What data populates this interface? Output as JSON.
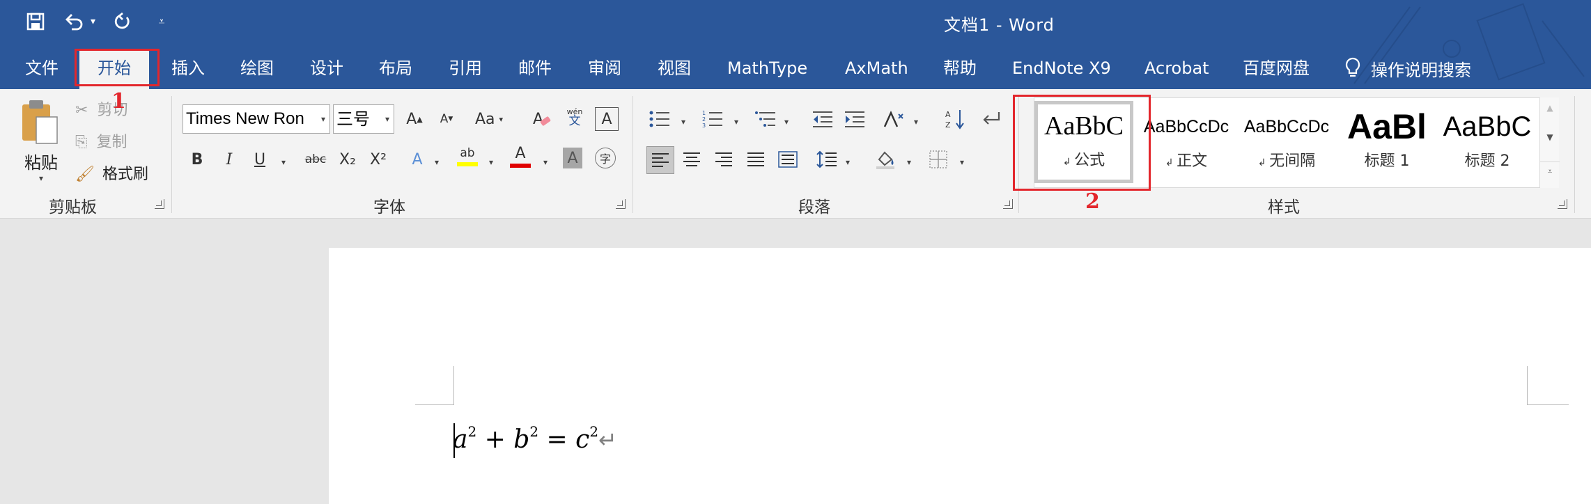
{
  "window": {
    "title": "文档1  -  Word"
  },
  "quick_access": {
    "save": "save-icon",
    "undo": "undo-icon",
    "redo": "redo-icon",
    "customize": "customize-icon"
  },
  "tabs": [
    "文件",
    "开始",
    "插入",
    "绘图",
    "设计",
    "布局",
    "引用",
    "邮件",
    "审阅",
    "视图",
    "MathType",
    "AxMath",
    "帮助",
    "EndNote X9",
    "Acrobat",
    "百度网盘"
  ],
  "active_tab": "开始",
  "tell_me": {
    "label": "操作说明搜索",
    "icon": "lightbulb-icon"
  },
  "clipboard": {
    "paste": "粘贴",
    "cut": "剪切",
    "copy": "复制",
    "format_painter": "格式刷",
    "label": "剪贴板"
  },
  "font": {
    "name": "Times New Ron",
    "size": "三号",
    "change_case": "Aa",
    "phonetic": "wén",
    "phonetic_char": "文",
    "bold": "B",
    "italic": "I",
    "underline": "U",
    "strikethrough": "abc",
    "subscript": "X₂",
    "superscript": "X²",
    "text_effects": "A",
    "highlight": "ab",
    "font_color": "A",
    "char_shading": "A",
    "enclosed": "字",
    "label": "字体"
  },
  "paragraph": {
    "label": "段落"
  },
  "styles": {
    "label": "样式",
    "items": [
      {
        "preview": "AaBbC",
        "name": "公式"
      },
      {
        "preview": "AaBbCcDc",
        "name": "正文"
      },
      {
        "preview": "AaBbCcDc",
        "name": "无间隔"
      },
      {
        "preview": "AaBl",
        "name": "标题 1"
      },
      {
        "preview": "AaBbC",
        "name": "标题 2"
      }
    ]
  },
  "annotations": {
    "one": "1",
    "two": "2"
  },
  "colors": {
    "accent": "#2b579a",
    "annotation": "#e3262c",
    "highlight": "#ffff00",
    "font_color": "#e00000"
  },
  "document": {
    "formula": {
      "a": "a",
      "a_exp": "2",
      "plus": "+",
      "b": "b",
      "b_exp": "2",
      "eq": "=",
      "c": "c",
      "c_exp": "2"
    },
    "paragraph_mark": "↵"
  }
}
